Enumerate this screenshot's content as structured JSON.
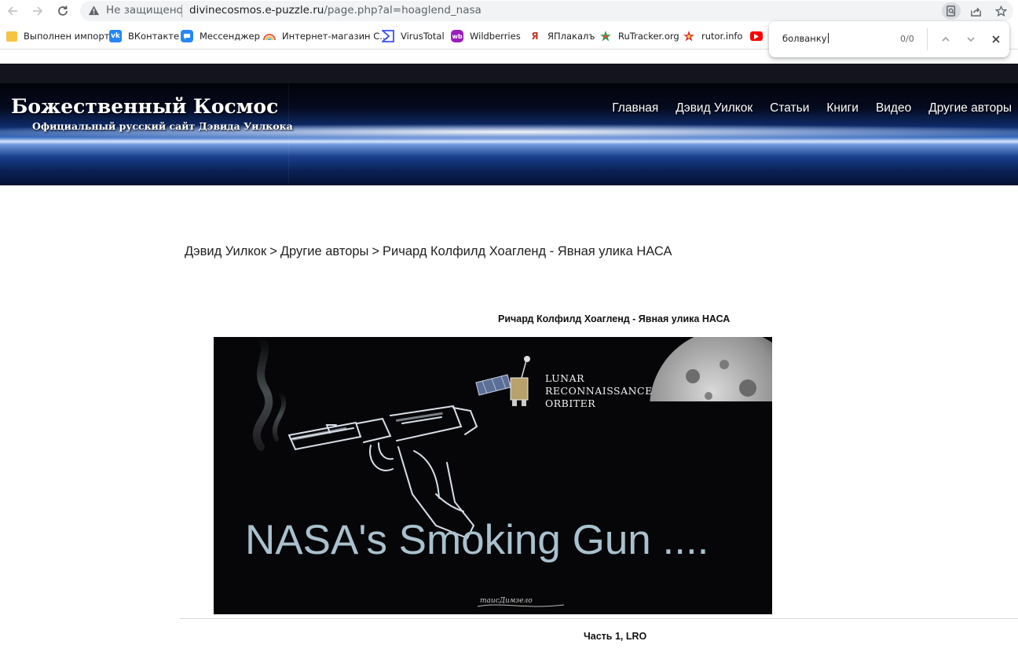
{
  "browser": {
    "security_label": "Не защищено",
    "url_host": "divinecosmos.e-puzzle.ru",
    "url_path": "/page.php?al=hoaglend_nasa",
    "icons": {
      "back": "arrow-left-icon",
      "forward": "arrow-right-icon",
      "reload": "reload-icon",
      "warning": "warning-triangle-icon",
      "zoom": "zoom-icon",
      "share": "share-icon",
      "bookmark": "star-icon"
    }
  },
  "bookmarks": [
    {
      "label": "Выполнен импорт",
      "icon": "folder-icon",
      "color": "#f6c343"
    },
    {
      "label": "ВКонтакте",
      "icon": "vk-icon",
      "color": "#2787f5"
    },
    {
      "label": "Мессенджер",
      "icon": "messenger-icon",
      "color": "#2787f5"
    },
    {
      "label": "Интернет-магазин С...",
      "icon": "rainbow-icon",
      "color": "#e9573f"
    },
    {
      "label": "VirusTotal",
      "icon": "virustotal-icon",
      "color": "#394eff"
    },
    {
      "label": "Wildberries",
      "icon": "wildberries-icon",
      "color": "#9b1cbf"
    },
    {
      "label": "ЯПлакалъ",
      "icon": "yaplakal-icon",
      "color": "#c0392b"
    },
    {
      "label": "RuTracker.org",
      "icon": "rutracker-icon",
      "color": "#2e9c4a"
    },
    {
      "label": "rutor.info",
      "icon": "rutor-icon",
      "color": "#d32f2f"
    },
    {
      "label": "",
      "icon": "youtube-icon",
      "color": "#ff0000"
    }
  ],
  "find_bar": {
    "query": "болванку",
    "count": "0/0"
  },
  "site": {
    "title": "Божественный Космос",
    "subtitle": "Официальный русский сайт Дэвида Уилкока",
    "nav": [
      "Главная",
      "Дэвид Уилкок",
      "Статьи",
      "Книги",
      "Видео",
      "Другие авторы"
    ]
  },
  "breadcrumb": {
    "items": [
      "Дэвид Уилкок",
      "Другие авторы",
      "Ричард Колфилд Хоагленд - Явная улика НАСА"
    ],
    "separator": ">"
  },
  "article": {
    "title": "Ричард Колфилд Хоагленд - Явная улика НАСА",
    "poster": {
      "headline": "NASA's Smoking Gun ....",
      "lro_lines": [
        "LUNAR",
        "RECONNAISSANCE",
        "ORBITER"
      ],
      "signature": "таисДимзело"
    },
    "part_heading": "Часть 1, LRO"
  }
}
